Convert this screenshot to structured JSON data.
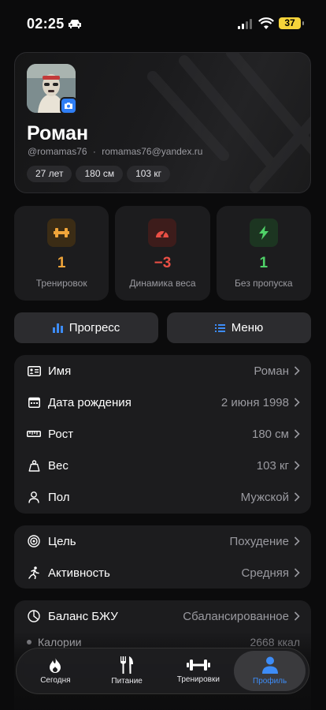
{
  "status_bar": {
    "time": "02:25",
    "battery": "37"
  },
  "profile": {
    "name": "Роман",
    "username": "@romamas76",
    "separator": "·",
    "email": "romamas76@yandex.ru",
    "chips": [
      "27 лет",
      "180 см",
      "103 кг"
    ]
  },
  "stats": [
    {
      "value": "1",
      "label": "Тренировок",
      "icon": "dumbbell-icon",
      "color": "#f0a53a",
      "bg": "#3b2c15"
    },
    {
      "value": "−3",
      "label": "Динамика веса",
      "icon": "speedometer-icon",
      "color": "#ea4f45",
      "bg": "#3d1c1b"
    },
    {
      "value": "1",
      "label": "Без пропуска",
      "icon": "lightning-icon",
      "color": "#4fd268",
      "bg": "#1c3521"
    }
  ],
  "actions": {
    "progress": "Прогресс",
    "menu": "Меню",
    "accent": "#3d8cf7"
  },
  "personal": [
    {
      "label": "Имя",
      "value": "Роман",
      "icon": "id-card-icon"
    },
    {
      "label": "Дата рождения",
      "value": "2 июня 1998",
      "icon": "calendar-icon"
    },
    {
      "label": "Рост",
      "value": "180 см",
      "icon": "ruler-icon"
    },
    {
      "label": "Вес",
      "value": "103 кг",
      "icon": "weight-icon"
    },
    {
      "label": "Пол",
      "value": "Мужской",
      "icon": "person-icon"
    }
  ],
  "goals": [
    {
      "label": "Цель",
      "value": "Похудение",
      "icon": "target-icon"
    },
    {
      "label": "Активность",
      "value": "Средняя",
      "icon": "running-icon"
    }
  ],
  "nutrition": {
    "label": "Баланс БЖУ",
    "value": "Сбалансированное",
    "icon": "pie-chart-icon",
    "items": [
      {
        "label": "Калории",
        "value": "2668 ккал"
      }
    ]
  },
  "tabs": [
    {
      "label": "Сегодня",
      "icon": "flame-icon",
      "active": false
    },
    {
      "label": "Питание",
      "icon": "fork-knife-icon",
      "active": false
    },
    {
      "label": "Тренировки",
      "icon": "dumbbell-icon",
      "active": false
    },
    {
      "label": "Профиль",
      "icon": "person-icon",
      "active": true
    }
  ]
}
